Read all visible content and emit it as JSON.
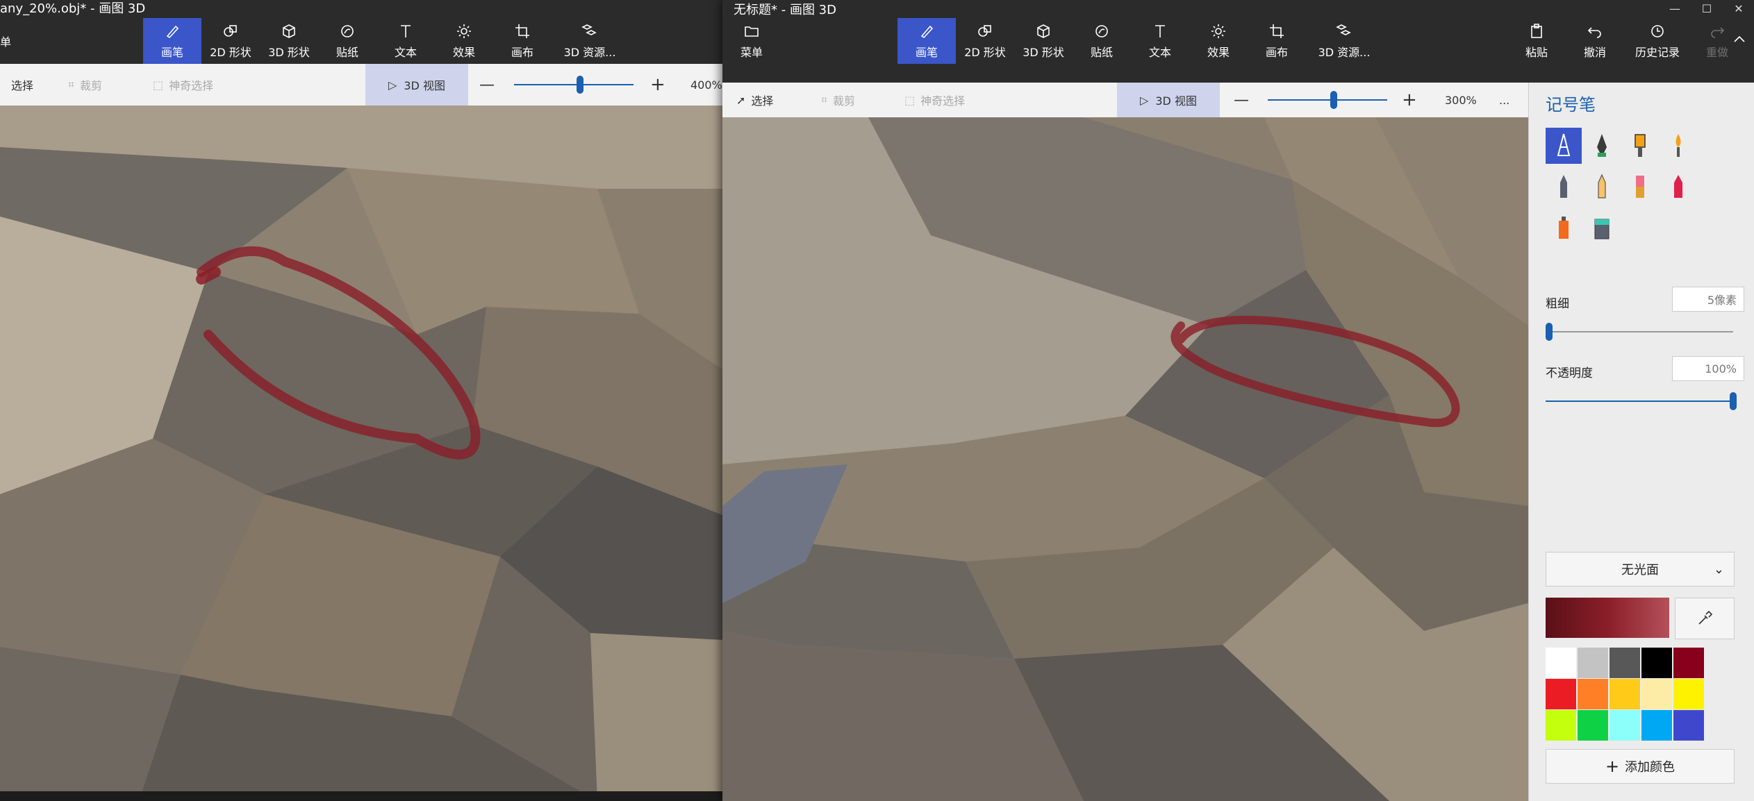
{
  "left_window": {
    "title": "any_20%.obj* - 画图 3D",
    "menu_partial": "单",
    "ribbon": [
      "画笔",
      "2D 形状",
      "3D 形状",
      "贴纸",
      "文本",
      "效果",
      "画布",
      "3D 资源..."
    ],
    "toolbar": {
      "select": "选择",
      "crop": "裁剪",
      "magic_select": "神奇选择",
      "view3d": "3D 视图",
      "zoom_label": "400%"
    },
    "zoom_level_fraction": 0.55
  },
  "right_window": {
    "title": "无标题* - 画图 3D",
    "menu_label": "菜单",
    "ribbon": [
      "画笔",
      "2D 形状",
      "3D 形状",
      "贴纸",
      "文本",
      "效果",
      "画布",
      "3D 资源..."
    ],
    "ribbon_right": {
      "paste": "粘贴",
      "undo": "撤消",
      "history": "历史记录",
      "redo": "重做"
    },
    "toolbar": {
      "select": "选择",
      "crop": "裁剪",
      "magic_select": "神奇选择",
      "view3d": "3D 视图",
      "zoom_label": "300%",
      "more": "..."
    },
    "zoom_level_fraction": 0.55,
    "window_controls": [
      "—",
      "☐",
      "✕"
    ]
  },
  "panel": {
    "title": "记号笔",
    "thickness_label": "粗细",
    "thickness_value": "5像素",
    "thickness_fraction": 0.02,
    "opacity_label": "不透明度",
    "opacity_value": "100%",
    "opacity_fraction": 1.0,
    "finish_select": "无光面",
    "current_color": "#8a1e28",
    "add_color": "添加颜色",
    "palette": [
      "#ffffff",
      "#c3c3c3",
      "#585858",
      "#000000",
      "#88001b",
      "#ec1c24",
      "#ff7f27",
      "#ffca18",
      "#fdeca6",
      "#fff200",
      "#c4ff0e",
      "#0ed145",
      "#8cfffb",
      "#00a8f3",
      "#3f48cc"
    ]
  },
  "colors": {
    "accent": "#3a56c9",
    "ink": "#8a1e28"
  }
}
